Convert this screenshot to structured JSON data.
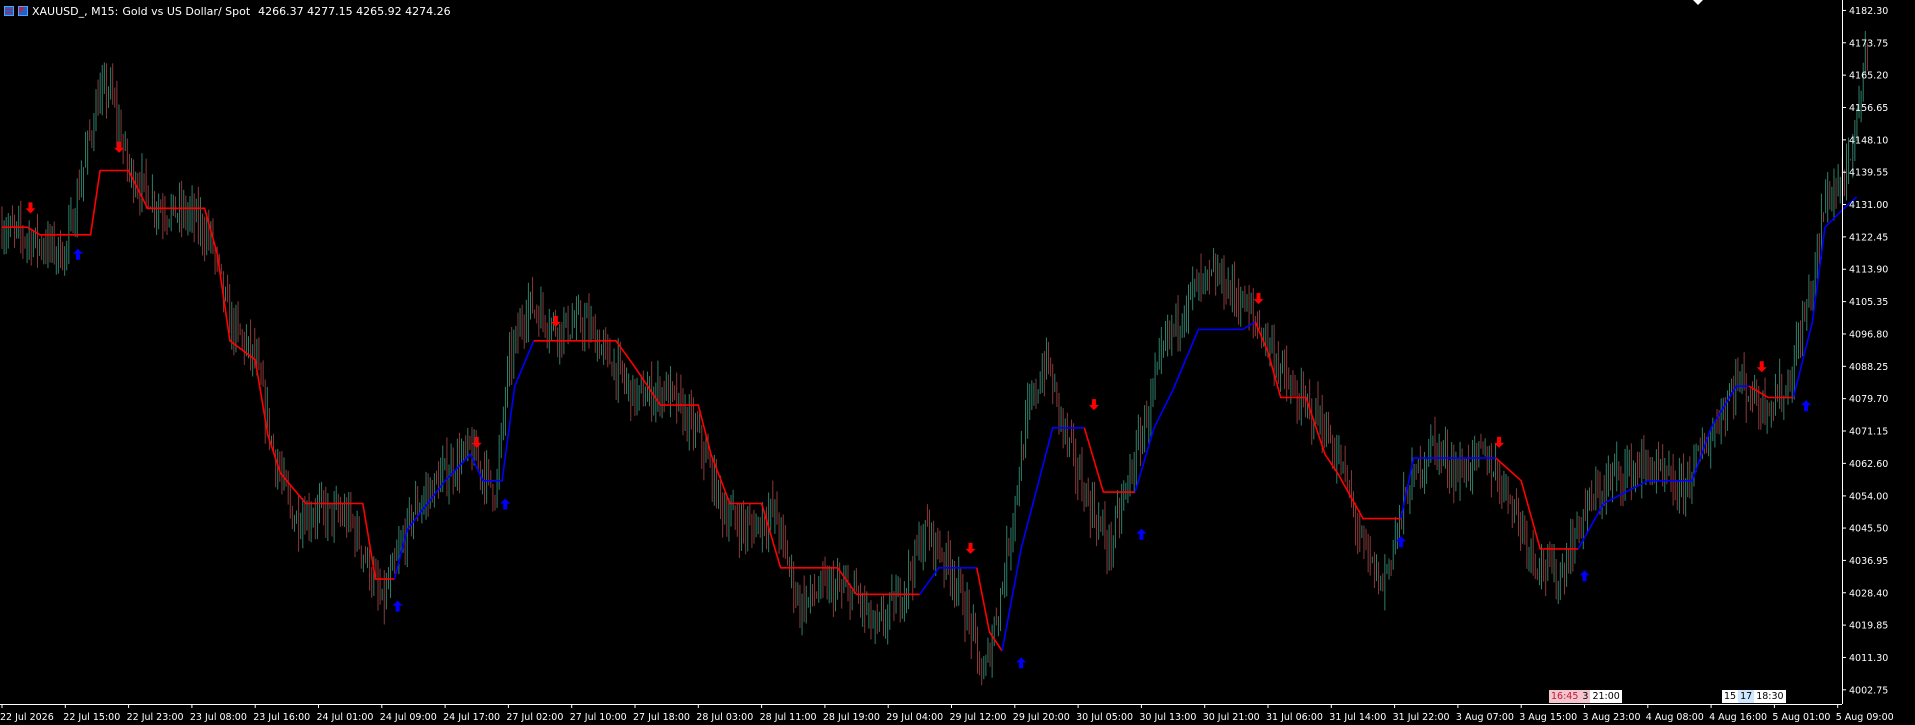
{
  "header": {
    "symbol": "XAUUSD_, M15:",
    "description": "Gold vs US Dollar/ Spot",
    "ohlc": "4266.37 4277.15 4265.92 4274.26"
  },
  "indicator_tags": {
    "first": [
      "16:45",
      "3",
      "21:00"
    ],
    "second": [
      "15",
      "17",
      "18:30"
    ]
  },
  "colors": {
    "background": "#000000",
    "axis": "#ffffff",
    "candle_up": "#2f7f6a",
    "candle_down": "#8b3a3a",
    "line_down": "#ff0000",
    "line_up": "#0000ff",
    "arrow_down": "#ff0000",
    "arrow_up": "#0000ff"
  },
  "chart_data": {
    "type": "line",
    "y_axis_ticks": [
      "4182.30",
      "4173.75",
      "4165.20",
      "4156.65",
      "4148.10",
      "4139.55",
      "4131.00",
      "4122.45",
      "4113.90",
      "4105.35",
      "4096.80",
      "4088.25",
      "4079.70",
      "4071.15",
      "4062.60",
      "4054.00",
      "4045.50",
      "4036.95",
      "4028.40",
      "4019.85",
      "4011.30",
      "4002.75"
    ],
    "x_axis_ticks": [
      "22 Jul 2026",
      "22 Jul 15:00",
      "22 Jul 23:00",
      "23 Jul 08:00",
      "23 Jul 16:00",
      "24 Jul 01:00",
      "24 Jul 09:00",
      "24 Jul 17:00",
      "27 Jul 02:00",
      "27 Jul 10:00",
      "27 Jul 18:00",
      "28 Jul 03:00",
      "28 Jul 11:00",
      "28 Jul 19:00",
      "29 Jul 04:00",
      "29 Jul 12:00",
      "29 Jul 20:00",
      "30 Jul 05:00",
      "30 Jul 13:00",
      "30 Jul 21:00",
      "31 Jul 06:00",
      "31 Jul 14:00",
      "31 Jul 22:00",
      "3 Aug 07:00",
      "3 Aug 15:00",
      "3 Aug 23:00",
      "4 Aug 08:00",
      "4 Aug 16:00",
      "5 Aug 01:00",
      "5 Aug 09:00"
    ],
    "price_path": [
      [
        0,
        4125
      ],
      [
        1.0,
        4118
      ],
      [
        1.5,
        4158
      ],
      [
        1.7,
        4162
      ],
      [
        2.0,
        4140
      ],
      [
        2.5,
        4130
      ],
      [
        3.0,
        4128
      ],
      [
        3.3,
        4122
      ],
      [
        3.6,
        4100
      ],
      [
        4.0,
        4090
      ],
      [
        4.3,
        4065
      ],
      [
        4.6,
        4048
      ],
      [
        5.0,
        4050
      ],
      [
        5.5,
        4048
      ],
      [
        5.8,
        4035
      ],
      [
        6.0,
        4025
      ],
      [
        6.5,
        4050
      ],
      [
        7.0,
        4060
      ],
      [
        7.4,
        4066
      ],
      [
        7.8,
        4055
      ],
      [
        8.0,
        4088
      ],
      [
        8.3,
        4105
      ],
      [
        8.8,
        4098
      ],
      [
        9.2,
        4100
      ],
      [
        9.6,
        4090
      ],
      [
        10.0,
        4080
      ],
      [
        10.5,
        4082
      ],
      [
        11.0,
        4070
      ],
      [
        11.4,
        4050
      ],
      [
        11.8,
        4045
      ],
      [
        12.2,
        4050
      ],
      [
        12.6,
        4025
      ],
      [
        13.0,
        4030
      ],
      [
        13.5,
        4028
      ],
      [
        13.8,
        4018
      ],
      [
        14.2,
        4028
      ],
      [
        14.6,
        4045
      ],
      [
        15.0,
        4035
      ],
      [
        15.3,
        4020
      ],
      [
        15.5,
        4005
      ],
      [
        15.8,
        4030
      ],
      [
        16.2,
        4075
      ],
      [
        16.5,
        4090
      ],
      [
        16.8,
        4070
      ],
      [
        17.1,
        4055
      ],
      [
        17.5,
        4040
      ],
      [
        18.0,
        4070
      ],
      [
        18.4,
        4095
      ],
      [
        18.8,
        4108
      ],
      [
        19.2,
        4112
      ],
      [
        19.6,
        4105
      ],
      [
        20.0,
        4095
      ],
      [
        20.4,
        4080
      ],
      [
        20.8,
        4075
      ],
      [
        21.2,
        4060
      ],
      [
        21.5,
        4040
      ],
      [
        21.8,
        4030
      ],
      [
        22.2,
        4055
      ],
      [
        22.6,
        4068
      ],
      [
        23.0,
        4060
      ],
      [
        23.4,
        4065
      ],
      [
        23.8,
        4055
      ],
      [
        24.2,
        4038
      ],
      [
        24.6,
        4032
      ],
      [
        25.0,
        4050
      ],
      [
        25.5,
        4060
      ],
      [
        26.0,
        4062
      ],
      [
        26.5,
        4055
      ],
      [
        27.0,
        4070
      ],
      [
        27.4,
        4085
      ],
      [
        27.8,
        4078
      ],
      [
        28.2,
        4082
      ],
      [
        28.6,
        4110
      ],
      [
        28.8,
        4132
      ],
      [
        29.2,
        4140
      ],
      [
        29.5,
        4178
      ]
    ],
    "series": [
      {
        "kind": "down",
        "points": [
          [
            0,
            4125
          ],
          [
            0.4,
            4125
          ],
          [
            0.6,
            4123
          ],
          [
            1.0,
            4123
          ],
          [
            1.4,
            4123
          ],
          [
            1.55,
            4140
          ],
          [
            2.0,
            4140
          ],
          [
            2.3,
            4130
          ],
          [
            3.2,
            4130
          ],
          [
            3.4,
            4118
          ],
          [
            3.6,
            4095
          ],
          [
            4.0,
            4090
          ],
          [
            4.2,
            4070
          ],
          [
            4.4,
            4060
          ],
          [
            4.8,
            4052
          ],
          [
            5.7,
            4052
          ],
          [
            5.9,
            4032
          ],
          [
            6.2,
            4032
          ]
        ]
      },
      {
        "kind": "up",
        "points": [
          [
            6.2,
            4032
          ],
          [
            6.4,
            4045
          ],
          [
            7.0,
            4058
          ],
          [
            7.4,
            4065
          ],
          [
            7.6,
            4058
          ],
          [
            7.9,
            4058
          ],
          [
            8.1,
            4083
          ],
          [
            8.4,
            4095
          ]
        ]
      },
      {
        "kind": "down",
        "points": [
          [
            8.4,
            4095
          ],
          [
            9.7,
            4095
          ],
          [
            10.0,
            4088
          ],
          [
            10.4,
            4078
          ],
          [
            11.0,
            4078
          ],
          [
            11.2,
            4065
          ],
          [
            11.5,
            4052
          ],
          [
            12.0,
            4052
          ],
          [
            12.3,
            4035
          ],
          [
            13.2,
            4035
          ],
          [
            13.5,
            4028
          ],
          [
            14.5,
            4028
          ]
        ]
      },
      {
        "kind": "up",
        "points": [
          [
            14.5,
            4028
          ],
          [
            14.8,
            4035
          ],
          [
            15.4,
            4035
          ]
        ]
      },
      {
        "kind": "down",
        "points": [
          [
            15.4,
            4035
          ],
          [
            15.6,
            4018
          ],
          [
            15.8,
            4013
          ]
        ]
      },
      {
        "kind": "up",
        "points": [
          [
            15.8,
            4013
          ],
          [
            16.1,
            4040
          ],
          [
            16.6,
            4072
          ],
          [
            17.1,
            4072
          ]
        ]
      },
      {
        "kind": "down",
        "points": [
          [
            17.1,
            4072
          ],
          [
            17.4,
            4055
          ],
          [
            17.9,
            4055
          ]
        ]
      },
      {
        "kind": "up",
        "points": [
          [
            17.9,
            4055
          ],
          [
            18.2,
            4072
          ],
          [
            18.5,
            4082
          ],
          [
            18.9,
            4098
          ],
          [
            19.6,
            4098
          ],
          [
            19.8,
            4100
          ]
        ]
      },
      {
        "kind": "down",
        "points": [
          [
            19.8,
            4100
          ],
          [
            20.0,
            4092
          ],
          [
            20.2,
            4080
          ],
          [
            20.6,
            4080
          ],
          [
            20.9,
            4065
          ],
          [
            21.1,
            4060
          ],
          [
            21.5,
            4048
          ],
          [
            22.1,
            4048
          ]
        ]
      },
      {
        "kind": "up",
        "points": [
          [
            22.1,
            4048
          ],
          [
            22.3,
            4064
          ],
          [
            23.6,
            4064
          ]
        ]
      },
      {
        "kind": "down",
        "points": [
          [
            23.6,
            4064
          ],
          [
            24.0,
            4058
          ],
          [
            24.3,
            4040
          ],
          [
            24.9,
            4040
          ]
        ]
      },
      {
        "kind": "up",
        "points": [
          [
            24.9,
            4040
          ],
          [
            25.3,
            4052
          ],
          [
            26.0,
            4058
          ],
          [
            26.7,
            4058
          ],
          [
            27.0,
            4072
          ],
          [
            27.4,
            4083
          ],
          [
            27.6,
            4083
          ]
        ]
      },
      {
        "kind": "down",
        "points": [
          [
            27.6,
            4083
          ],
          [
            27.9,
            4080
          ],
          [
            28.3,
            4080
          ]
        ]
      },
      {
        "kind": "up",
        "points": [
          [
            28.3,
            4080
          ],
          [
            28.6,
            4100
          ],
          [
            28.8,
            4125
          ],
          [
            29.1,
            4130
          ],
          [
            29.3,
            4133
          ]
        ]
      }
    ],
    "signals_down": [
      [
        0.45,
        4130
      ],
      [
        1.85,
        4146
      ],
      [
        7.5,
        4068
      ],
      [
        8.75,
        4100
      ],
      [
        15.3,
        4040
      ],
      [
        17.25,
        4078
      ],
      [
        19.85,
        4106
      ],
      [
        23.65,
        4068
      ],
      [
        27.8,
        4088
      ]
    ],
    "signals_up": [
      [
        1.2,
        4118
      ],
      [
        6.25,
        4025
      ],
      [
        7.95,
        4052
      ],
      [
        16.1,
        4010
      ],
      [
        18.0,
        4044
      ],
      [
        22.1,
        4042
      ],
      [
        25.0,
        4033
      ],
      [
        28.5,
        4078
      ]
    ],
    "ylim": [
      3999,
      4184
    ],
    "xlim": [
      0,
      29.5
    ]
  }
}
